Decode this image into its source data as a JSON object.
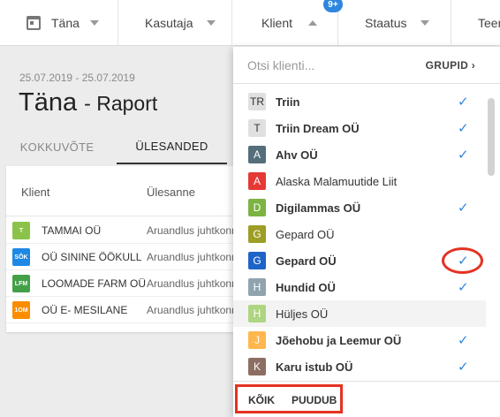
{
  "filterbar": {
    "items": [
      {
        "label": "Täna"
      },
      {
        "label": "Kasutaja"
      },
      {
        "label": "Klient",
        "badge": "9+"
      },
      {
        "label": "Staatus"
      },
      {
        "label": "Teen"
      }
    ]
  },
  "report": {
    "date_range": "25.07.2019 - 25.07.2019",
    "title": "Täna",
    "subtitle": "- Raport",
    "tabs": [
      {
        "label": "KOKKUVÕTE",
        "active": false
      },
      {
        "label": "ÜLESANDED",
        "active": true
      }
    ],
    "columns": [
      "Klient",
      "Ülesanne"
    ],
    "rows": [
      {
        "avatar": "T",
        "color": "#8bc34a",
        "client": "TAMMAI OÜ",
        "task": "Aruandlus juhtkonnale"
      },
      {
        "avatar": "SÕK",
        "color": "#1e88e5",
        "client": "OÜ SININE ÖÖKULL",
        "task": "Aruandlus juhtkonnale"
      },
      {
        "avatar": "LFM",
        "color": "#43a047",
        "client": "LOOMADE FARM OÜ",
        "task": "Aruandlus juhtkonnale"
      },
      {
        "avatar": "1OM",
        "color": "#fb8c00",
        "client": "OÜ E- MESILANE",
        "task": "Aruandlus juhtkonnale"
      }
    ]
  },
  "dropdown": {
    "search_placeholder": "Otsi klienti...",
    "groups_label": "GRUPID ›",
    "clients": [
      {
        "letter": "TR",
        "color": "#e0e0e0",
        "name": "Triin",
        "checked": true
      },
      {
        "letter": "T",
        "color": "#e0e0e0",
        "name": "Triin Dream OÜ",
        "checked": true
      },
      {
        "letter": "A",
        "color": "#546e7a",
        "name": "Ahv OÜ",
        "checked": true
      },
      {
        "letter": "A",
        "color": "#e53935",
        "name": "Alaska Malamuutide Liit",
        "checked": false
      },
      {
        "letter": "D",
        "color": "#7cb342",
        "name": "Digilammas OÜ",
        "checked": true
      },
      {
        "letter": "G",
        "color": "#9e9d24",
        "name": "Gepard OÜ",
        "checked": false
      },
      {
        "letter": "G",
        "color": "#1e64c8",
        "name": "Gepard OÜ",
        "checked": true
      },
      {
        "letter": "H",
        "color": "#90a4ae",
        "name": "Hundid OÜ",
        "checked": true
      },
      {
        "letter": "H",
        "color": "#aed581",
        "name": "Hüljes OÜ",
        "checked": false
      },
      {
        "letter": "J",
        "color": "#ffb74d",
        "name": "Jõehobu ja Leemur OÜ",
        "checked": true
      },
      {
        "letter": "K",
        "color": "#8d6e63",
        "name": "Karu istub OÜ",
        "checked": true
      }
    ],
    "check_glyph": "✓",
    "footer": {
      "all_label": "KÕIK",
      "none_label": "PUUDUB"
    }
  },
  "colors": {
    "accent": "#2e86de",
    "annotation": "#e53222"
  }
}
